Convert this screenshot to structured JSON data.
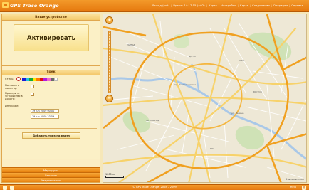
{
  "header": {
    "brand": "GPS Trace Orange",
    "nav": [
      "Выход (exit)",
      "Время: 14:17:55 (+02)",
      "Карта",
      "Настройки",
      "Карта",
      "Соединения",
      "Операции",
      "Справка"
    ]
  },
  "device_panel": {
    "title": "Ваше устройство",
    "activate_label": "Активировать"
  },
  "track_panel": {
    "title": "Трек",
    "color_label": "Стиль:",
    "rows": [
      {
        "label": "Поставить монитор:"
      },
      {
        "label": "Проверить устройство в дороге:"
      }
    ],
    "interval_label": "Интервал:",
    "date_from": "19 Jun 2009 00:00",
    "date_to": "19 Jun 2009 23:59",
    "add_button": "Добавить трек на карту",
    "palette": [
      "#1b1bd6",
      "#23c1e8",
      "#11a83a",
      "#ffe400",
      "#ff7a00",
      "#e01010",
      "#b01de0",
      "#f06ad0",
      "#6a6a6a",
      "#ffffff"
    ]
  },
  "left_tabs": [
    "Маршруты",
    "Геозоны",
    "Уведомления"
  ],
  "map": {
    "scale_label": "1000 m",
    "copyright": "© GPS-Trace.com"
  },
  "footer": {
    "text": "© GPS Trace Orange, 2008 – 2009",
    "help": "Help"
  },
  "colors": {
    "accent": "#e5780e",
    "panel": "#fbf0c6"
  }
}
